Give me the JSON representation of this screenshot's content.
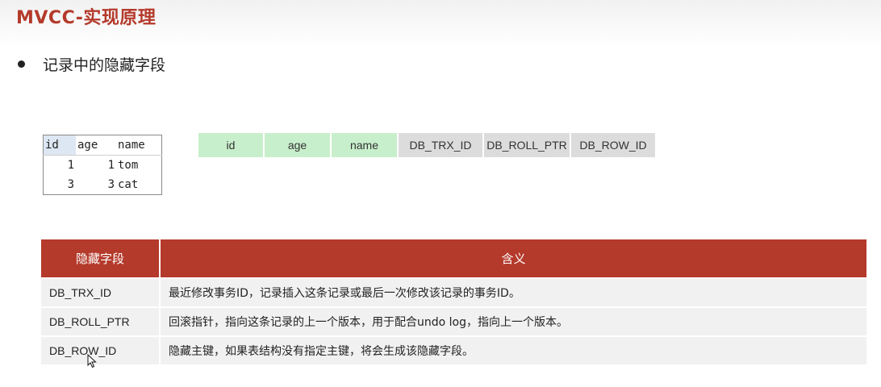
{
  "slide": {
    "title": "MVCC-实现原理",
    "bullet": "记录中的隐藏字段"
  },
  "sample_table": {
    "headers": [
      "id",
      "age",
      "name"
    ],
    "rows": [
      [
        "1",
        "1",
        "tom"
      ],
      [
        "3",
        "3",
        "cat"
      ]
    ]
  },
  "fields": {
    "visible": [
      "id",
      "age",
      "name"
    ],
    "hidden": [
      "DB_TRX_ID",
      "DB_ROLL_PTR",
      "DB_ROW_ID"
    ]
  },
  "meaning_table": {
    "headers": [
      "隐藏字段",
      "含义"
    ],
    "rows": [
      [
        "DB_TRX_ID",
        "最近修改事务ID，记录插入这条记录或最后一次修改该记录的事务ID。"
      ],
      [
        "DB_ROLL_PTR",
        "回滚指针，指向这条记录的上一个版本，用于配合undo log，指向上一个版本。"
      ],
      [
        "DB_ROW_ID",
        "隐藏主键，如果表结构没有指定主键，将会生成该隐藏字段。"
      ]
    ]
  },
  "colors": {
    "accent": "#b43a2b",
    "visible_field": "#c8efcb",
    "hidden_field": "#dcdcdc",
    "row_bg": "#f1f1f1"
  },
  "icons": {
    "cursor": "mouse-pointer-icon",
    "bullet": "bullet-dot-icon"
  }
}
